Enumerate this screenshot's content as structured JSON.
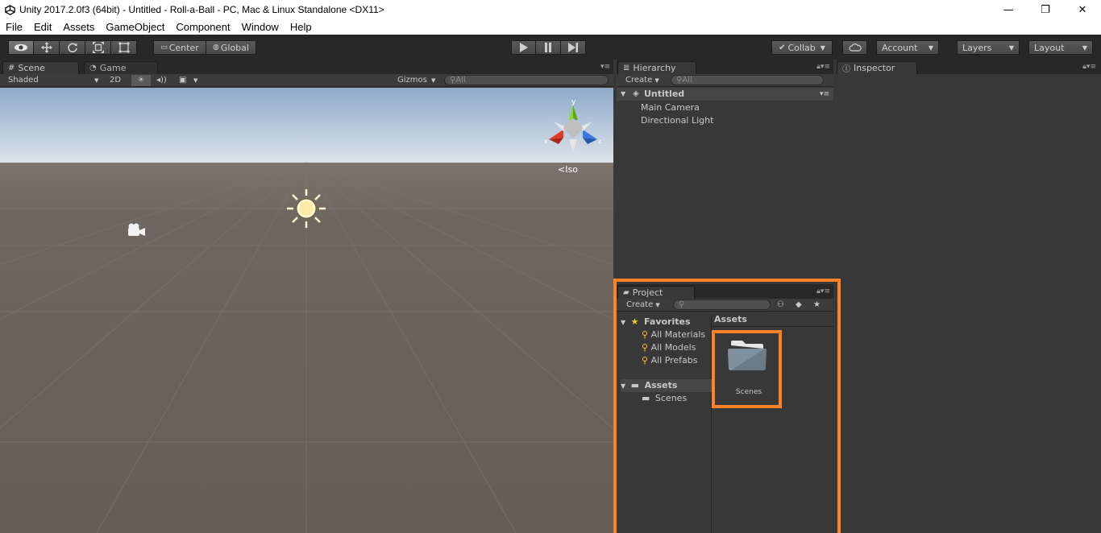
{
  "window": {
    "title": "Unity 2017.2.0f3 (64bit) - Untitled - Roll-a-Ball - PC, Mac & Linux Standalone <DX11>",
    "minimize": "—",
    "maximize": "❐",
    "close": "✕"
  },
  "menu": [
    "File",
    "Edit",
    "Assets",
    "GameObject",
    "Component",
    "Window",
    "Help"
  ],
  "toolbar": {
    "pivot": "Center",
    "space": "Global",
    "collab": "Collab",
    "account": "Account",
    "layers": "Layers",
    "layout": "Layout"
  },
  "scene": {
    "tab_scene": "Scene",
    "tab_game": "Game",
    "shading": "Shaded",
    "mode_2d": "2D",
    "gizmos": "Gizmos",
    "search_placeholder": "All",
    "iso": "Iso",
    "axis_x": "x",
    "axis_y": "y",
    "axis_z": "z"
  },
  "hierarchy": {
    "tab": "Hierarchy",
    "create": "Create",
    "search_placeholder": "All",
    "scene_name": "Untitled",
    "items": [
      "Main Camera",
      "Directional Light"
    ]
  },
  "inspector": {
    "tab": "Inspector"
  },
  "project": {
    "tab": "Project",
    "create": "Create",
    "favorites": "Favorites",
    "favorite_items": [
      "All Materials",
      "All Models",
      "All Prefabs"
    ],
    "assets_root": "Assets",
    "asset_folders": [
      "Scenes"
    ],
    "breadcrumb": "Assets",
    "grid_items": [
      "Scenes"
    ]
  },
  "colors": {
    "highlight": "#ff8225",
    "sky": "#b4c8df",
    "ground": "#666056"
  }
}
